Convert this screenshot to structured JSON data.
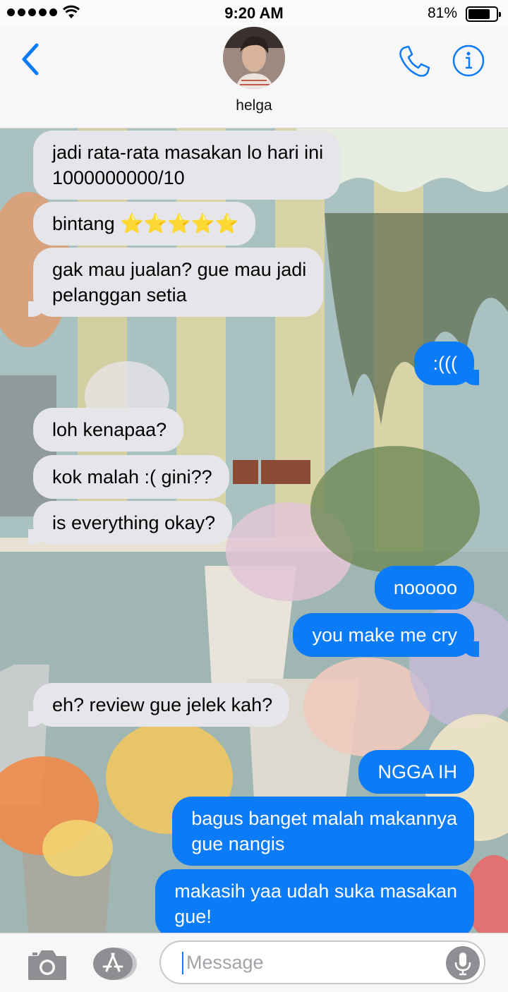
{
  "status_bar": {
    "time": "9:20 AM",
    "battery_percent": "81%",
    "battery_level": 0.81,
    "signal_icon": "signal-dots-icon",
    "wifi_icon": "wifi-icon"
  },
  "header": {
    "contact_name": "helga",
    "back_icon": "chevron-left-icon",
    "call_icon": "phone-icon",
    "info_icon": "info-icon",
    "accent_color": "#0b7bf8"
  },
  "messages": [
    {
      "direction": "incoming",
      "lines": [
        "jadi rata-rata masakan lo hari ini",
        "1000000000/10"
      ]
    },
    {
      "direction": "incoming",
      "lines": [
        "bintang ⭐⭐⭐⭐⭐"
      ]
    },
    {
      "direction": "incoming",
      "lines": [
        "gak mau jualan? gue mau jadi",
        "pelanggan setia"
      ]
    },
    {
      "direction": "outgoing",
      "lines": [
        ":((("
      ]
    },
    {
      "direction": "incoming",
      "lines": [
        "loh kenapaa?"
      ]
    },
    {
      "direction": "incoming",
      "lines": [
        "kok malah :( gini??"
      ]
    },
    {
      "direction": "incoming",
      "lines": [
        "is everything okay?"
      ]
    },
    {
      "direction": "outgoing",
      "lines": [
        "nooooo"
      ]
    },
    {
      "direction": "outgoing",
      "lines": [
        "you make me cry"
      ]
    },
    {
      "direction": "incoming",
      "lines": [
        "eh? review gue jelek kah?"
      ]
    },
    {
      "direction": "outgoing",
      "lines": [
        "NGGA IH"
      ]
    },
    {
      "direction": "outgoing",
      "lines": [
        "bagus banget malah makannya",
        "gue nangis"
      ]
    },
    {
      "direction": "outgoing",
      "lines": [
        "makasih yaa udah suka masakan",
        "gue!"
      ]
    }
  ],
  "bubble_colors": {
    "incoming": "#e5e5ea",
    "outgoing": "#0b7bf8"
  },
  "input_bar": {
    "placeholder": "Message",
    "camera_icon": "camera-icon",
    "apps_icon": "app-store-icon",
    "mic_icon": "microphone-icon"
  }
}
